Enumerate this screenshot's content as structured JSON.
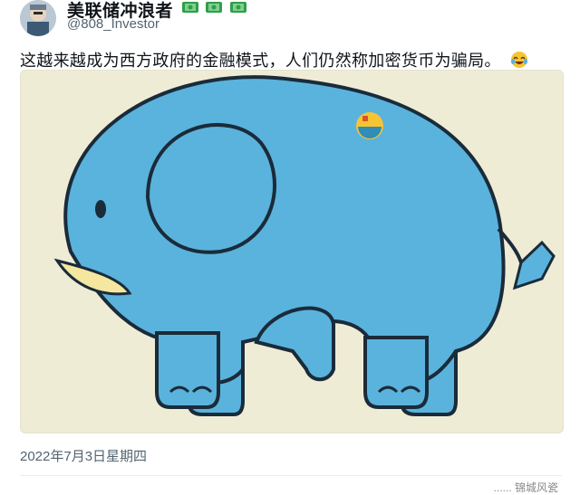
{
  "author": {
    "display_name": "美联储冲浪者",
    "handle": "@808_Investor",
    "badges": [
      "money-icon",
      "money-icon",
      "money-icon"
    ]
  },
  "tweet": {
    "text": "这越来越成为西方政府的金融模式，人们仍然称加密货币为骗局。",
    "emoji": "laughing-tears-icon",
    "timestamp": "2022年7月3日星期四"
  },
  "media": {
    "description_icon": "elephant-illustration",
    "badge_icon": "bitcoin-logo-icon"
  },
  "footer": {
    "watermark": "...... 锦城风瓷"
  },
  "colors": {
    "elephant": "#5ab3dc",
    "outline": "#1a2b3a",
    "tusk": "#f5e7a0",
    "background": "#efecd6",
    "money": "#2e9e4a"
  }
}
